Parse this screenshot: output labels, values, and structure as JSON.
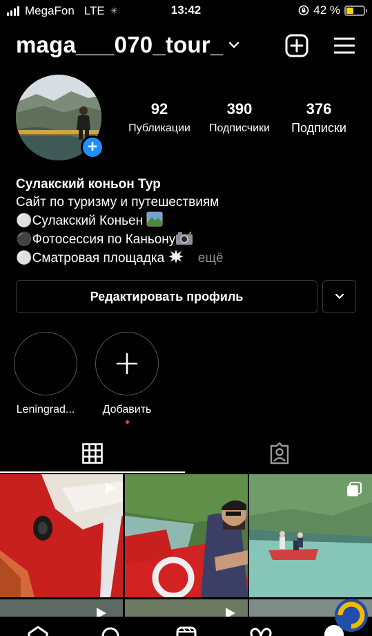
{
  "status_bar": {
    "carrier": "MegaFon",
    "network": "LTE",
    "time": "13:42",
    "battery": "42 %",
    "battery_level": 0.42
  },
  "header": {
    "username": "maga___070_tour_"
  },
  "profile": {
    "stats": [
      {
        "value": "92",
        "label": "Публикации"
      },
      {
        "value": "390",
        "label": "Подписчики"
      },
      {
        "value": "376",
        "label": "Подписки"
      }
    ],
    "name": "Сулакский коньон Тур",
    "bio_lines": [
      "Сайт по туризму и путешествиям",
      "Сулакский Коньен",
      "Фотосессия по Каньону",
      "Сматровая площадка"
    ],
    "more": "ещё",
    "edit_button": "Редактировать профиль"
  },
  "highlights": [
    {
      "label": "Leningrad..."
    },
    {
      "label": "Добавить"
    }
  ],
  "colors": {
    "accent": "#1f8fff",
    "background": "#000000",
    "notification_dot": "#ff3b5c",
    "battery": "#ffd60a"
  }
}
